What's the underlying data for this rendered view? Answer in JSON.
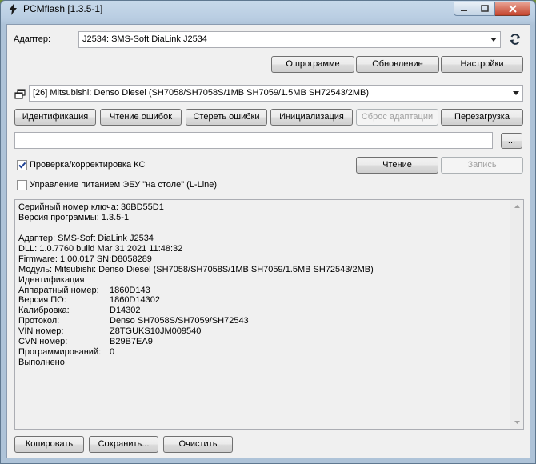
{
  "window": {
    "title": "PCMflash [1.3.5-1]"
  },
  "adapter": {
    "label": "Адаптер:",
    "selected": "J2534: SMS-Soft DiaLink J2534"
  },
  "top_buttons": {
    "about": "О программе",
    "update": "Обновление",
    "settings": "Настройки"
  },
  "module": {
    "selected": "[26] Mitsubishi: Denso Diesel (SH7058/SH7058S/1MB SH7059/1.5MB SH72543/2MB)"
  },
  "action_buttons": {
    "identify": "Идентификация",
    "read_errors": "Чтение ошибок",
    "clear_errors": "Стереть ошибки",
    "initialize": "Инициализация",
    "reset_adaptation": "Сброс адаптации",
    "reboot": "Перезагрузка"
  },
  "file": {
    "value": "",
    "browse": "..."
  },
  "checksum": {
    "label": "Проверка/корректировка КС",
    "checked": true
  },
  "read_button": "Чтение",
  "write_button": "Запись",
  "power": {
    "label": "Управление питанием ЭБУ \"на столе\" (L-Line)",
    "checked": false
  },
  "log": {
    "lines": [
      {
        "text": "Серийный номер ключа: 36BD55D1"
      },
      {
        "text": "Версия программы: 1.3.5-1"
      },
      {
        "text": ""
      },
      {
        "text": "Адаптер: SMS-Soft DiaLink J2534"
      },
      {
        "text": "DLL: 1.0.7760 build Mar 31 2021 11:48:32"
      },
      {
        "text": "Firmware: 1.00.017 SN:D8058289"
      },
      {
        "text": "Модуль: Mitsubishi: Denso Diesel (SH7058/SH7058S/1MB SH7059/1.5MB SH72543/2MB)"
      },
      {
        "text": "Идентификация"
      },
      {
        "key": "Аппаратный номер:",
        "value": "1860D143"
      },
      {
        "key": "Версия ПО:",
        "value": "1860D14302"
      },
      {
        "key": "Калибровка:",
        "value": "D14302"
      },
      {
        "key": "Протокол:",
        "value": "Denso SH7058S/SH7059/SH72543"
      },
      {
        "key": "VIN номер:",
        "value": "Z8TGUKS10JM009540"
      },
      {
        "key": "CVN номер:",
        "value": "B29B7EA9"
      },
      {
        "key": "Программирований:",
        "value": "0"
      },
      {
        "text": "Выполнено"
      }
    ]
  },
  "bottom_buttons": {
    "copy": "Копировать",
    "save": "Сохранить...",
    "clear": "Очистить"
  },
  "colors": {
    "accent_checkmark": "#1c3f94",
    "refresh_icon": "#1f2f3f"
  }
}
